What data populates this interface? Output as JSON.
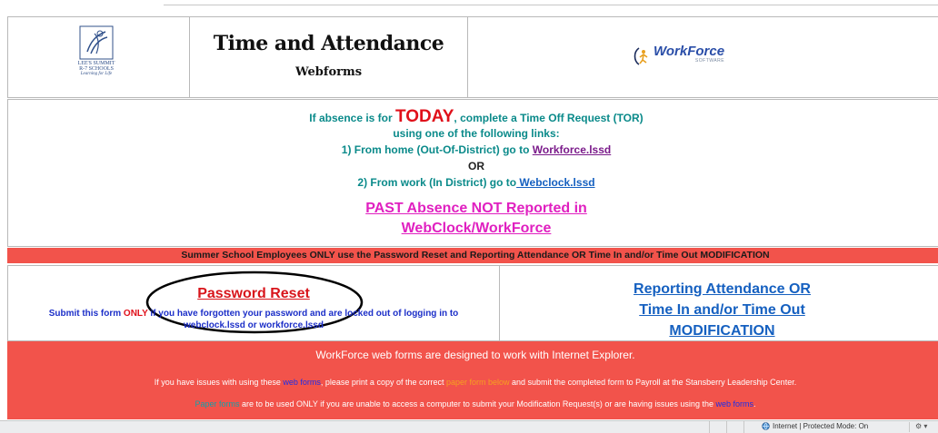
{
  "header": {
    "school_name_lines": [
      "LEE'S SUMMIT",
      "R-7 SCHOOLS"
    ],
    "school_tagline": "Learning for Life",
    "title": "Time and Attendance",
    "subtitle": "Webforms",
    "workforce_name": "WorkForce",
    "workforce_sub": "SOFTWARE"
  },
  "instructions": {
    "line1_prefix": "If absence is for ",
    "line1_today": "TODAY",
    "line1_suffix": ",  complete a Time Off Request (TOR)",
    "line2": "using one of the following links:",
    "line3_prefix": "1) From home (Out-Of-District) go to ",
    "line3_link": "Workforce.lssd",
    "line4": "OR",
    "line5_prefix": "2) From work (In District) go to",
    "line5_link": " Webclock.lssd",
    "past_line1": "PAST Absence NOT Reported in",
    "past_line2": "WebClock/WorkForce"
  },
  "banner": {
    "text": "Summer School Employees ONLY use the Password Reset and Reporting Attendance OR Time In and/or Time Out MODIFICATION"
  },
  "forms": {
    "password_reset": "Password Reset",
    "submit_prefix": "Submit this form ",
    "submit_only": "ONLY",
    "submit_suffix": " if you have forgotten your password and are locked out of logging in to",
    "submit_line2": "webclock.lssd or workforce.lssd",
    "reporting_line1": "Reporting Attendance OR",
    "reporting_line2": "Time In and/or Time Out",
    "reporting_line3": "MODIFICATION"
  },
  "bottom": {
    "line1": "WorkForce web forms are designed to work with Internet Explorer.",
    "line2_a": "If you have issues with using these ",
    "line2_web_forms": "web forms",
    "line2_b": ", please print a copy of the correct ",
    "line2_paper": "paper form below",
    "line2_c": " and submit the completed form  to Payroll at the Stansberry Leadership Center.",
    "line3_paper": "Paper forms",
    "line3_a": " are to be used ONLY if you are unable to access a computer to submit your Modification Request(s) or are having issues using the ",
    "line3_web_forms": "web forms",
    "line3_end": "."
  },
  "statusbar": {
    "zone_text": "Internet | Protected Mode: On",
    "zoom_text": "⚙ ▾"
  }
}
